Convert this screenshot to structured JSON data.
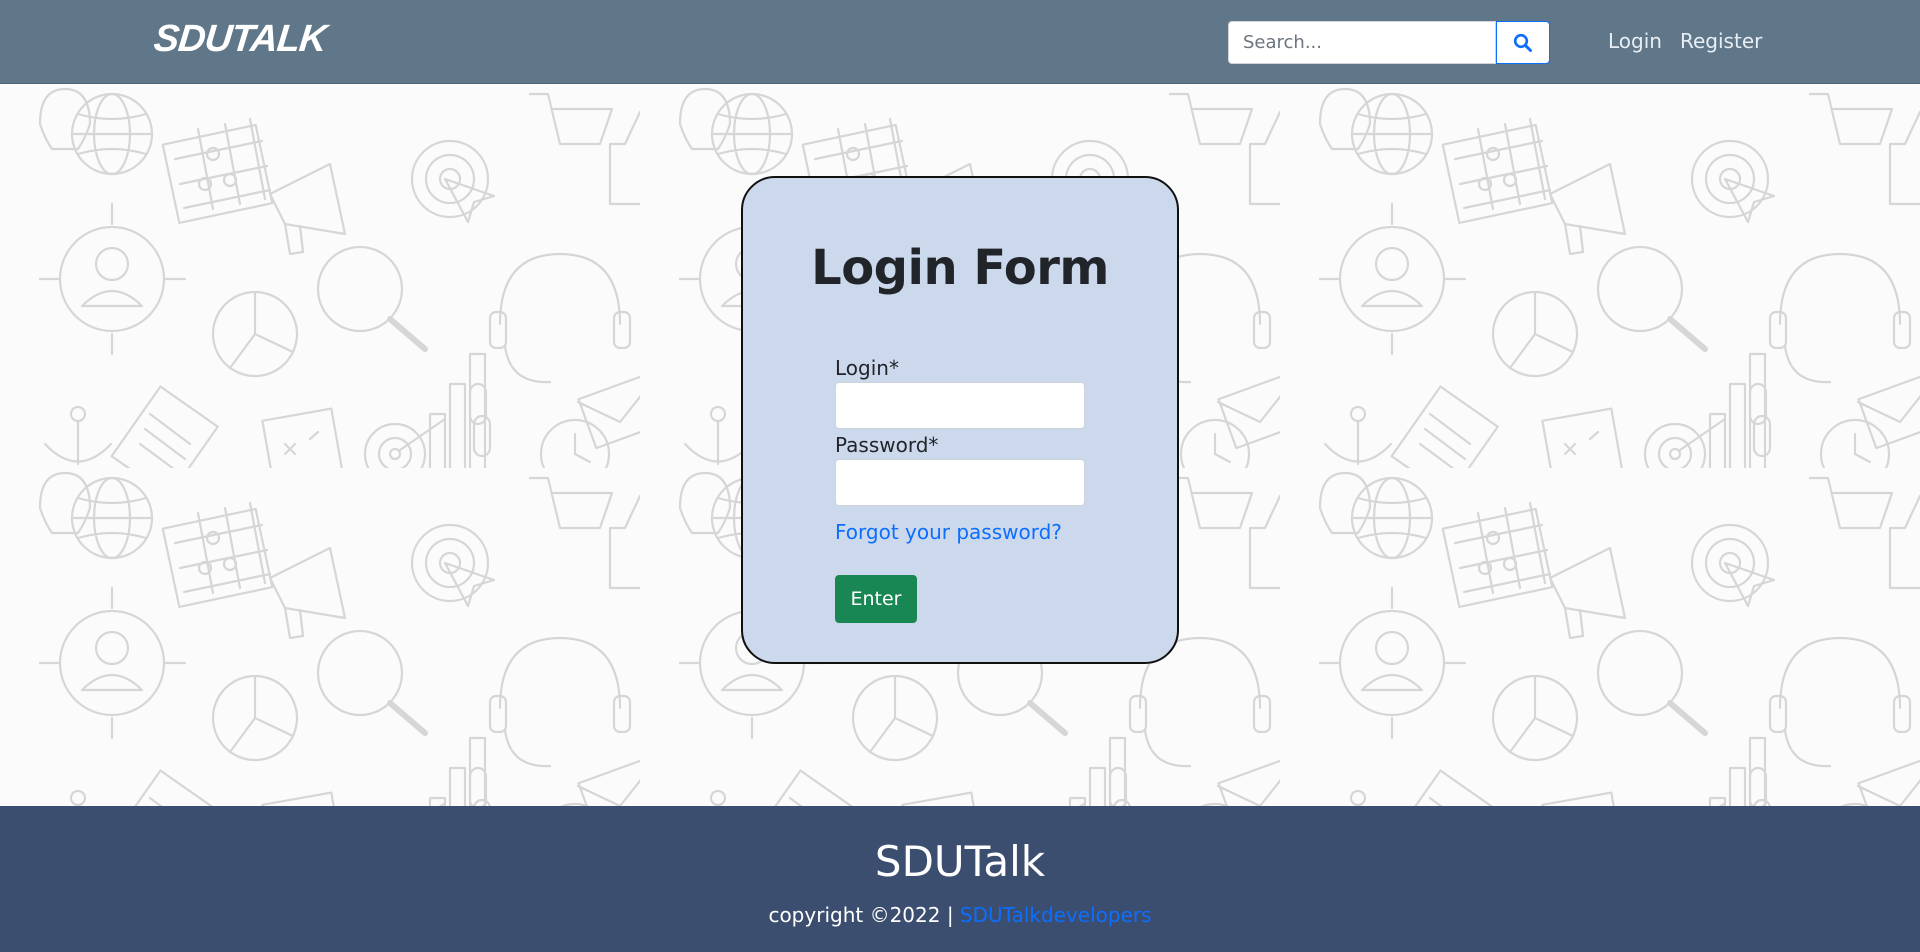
{
  "header": {
    "logo_text": "SDUTALK",
    "search": {
      "placeholder": "Search...",
      "value": "",
      "button_icon": "search-icon"
    },
    "nav": {
      "login": "Login",
      "register": "Register"
    }
  },
  "login_form": {
    "title": "Login Form",
    "login_label": "Login*",
    "login_value": "",
    "password_label": "Password*",
    "password_value": "",
    "forgot_link": "Forgot your password?",
    "submit_label": "Enter"
  },
  "footer": {
    "title": "SDUTalk",
    "copyright": "copyright ©2022 |",
    "developers_link": "SDUTalkdevelopers"
  },
  "colors": {
    "header_bg": "#5f7789",
    "card_bg": "#ccd9ec",
    "enter_button": "#198754",
    "link": "#0d6efd",
    "footer_bg": "#3c4e6f"
  }
}
